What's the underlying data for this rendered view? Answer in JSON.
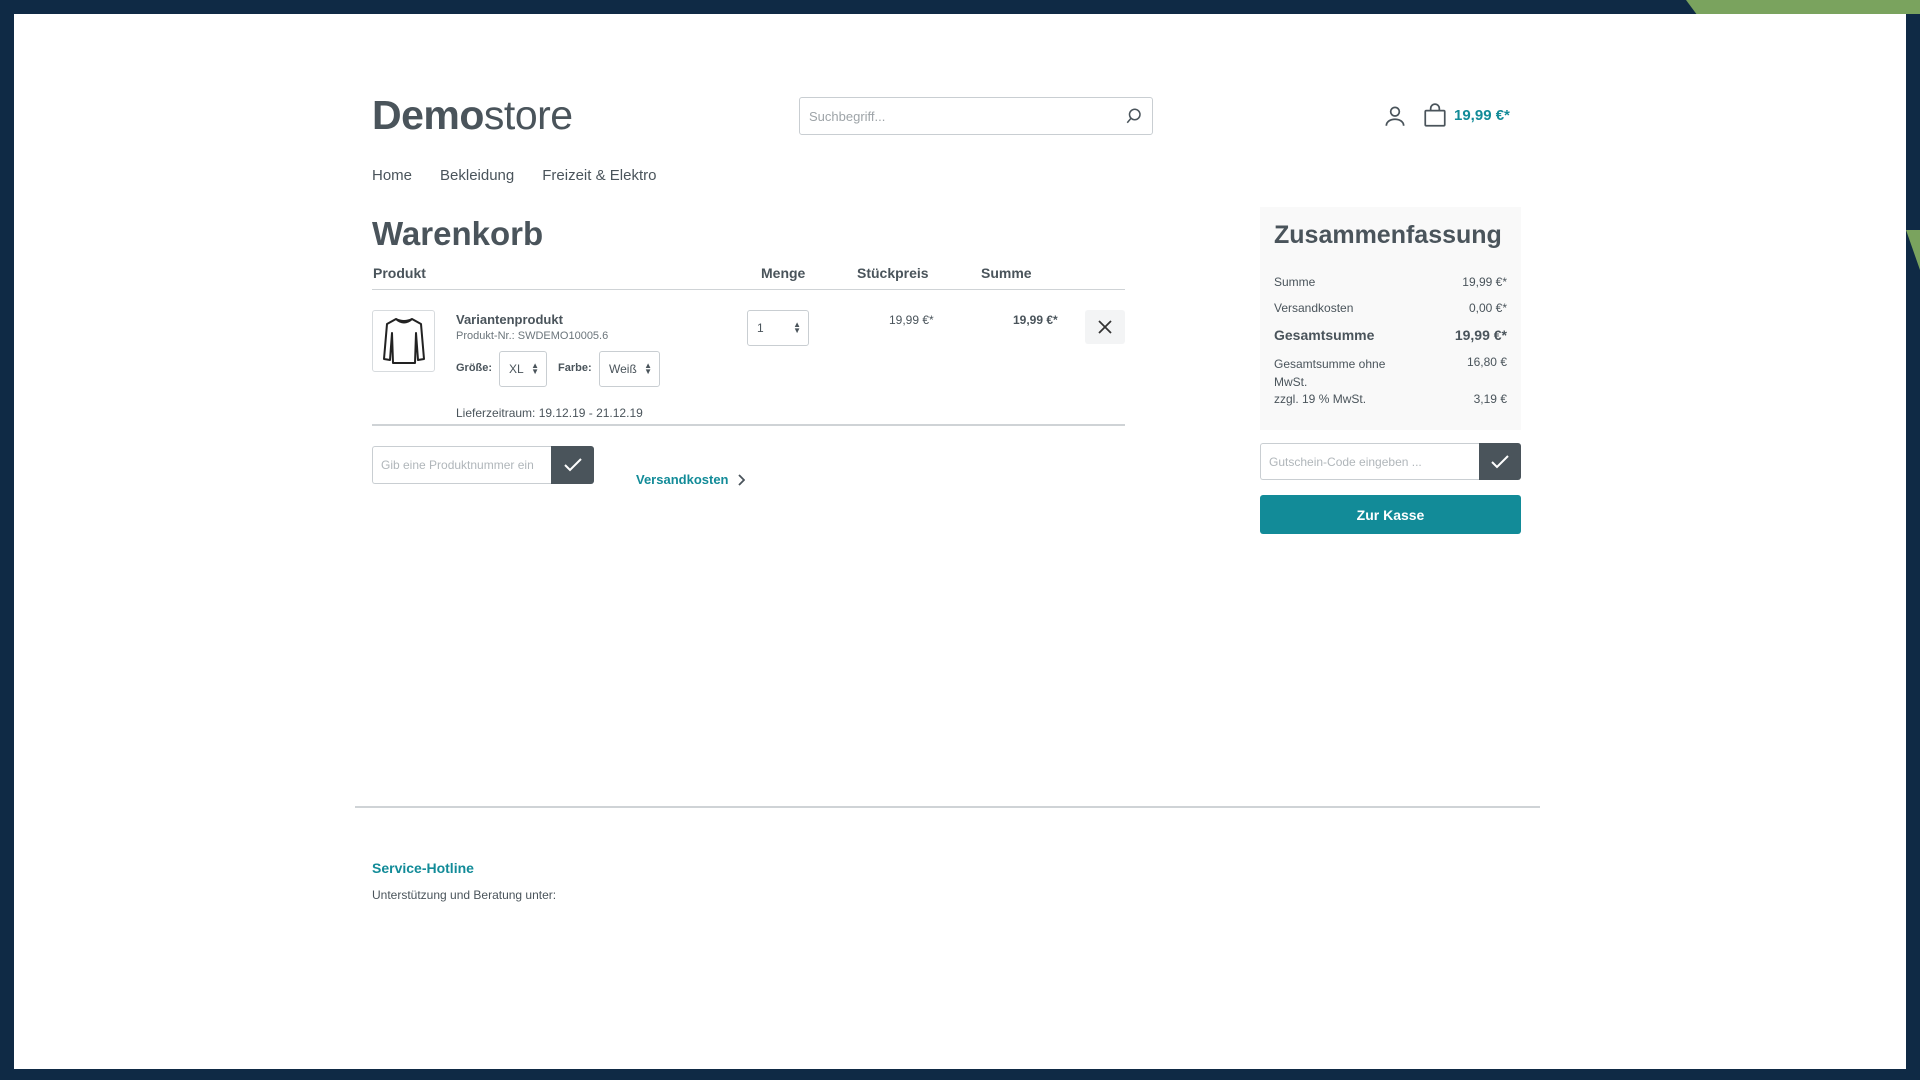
{
  "brand": {
    "logo_bold": "Demo",
    "logo_light": "store"
  },
  "search": {
    "placeholder": "Suchbegriff..."
  },
  "header": {
    "cart_total": "19,99 €*"
  },
  "nav": {
    "items": [
      "Home",
      "Bekleidung",
      "Freizeit & Elektro"
    ]
  },
  "cart": {
    "title": "Warenkorb",
    "columns": {
      "product": "Produkt",
      "quantity": "Menge",
      "unit_price": "Stückpreis",
      "sum": "Summe"
    },
    "items": [
      {
        "name": "Variantenprodukt",
        "product_number": "Produkt-Nr.: SWDEMO10005.6",
        "size_label": "Größe:",
        "size_value": "XL",
        "color_label": "Farbe:",
        "color_value": "Weiß",
        "delivery": "Lieferzeitraum: 19.12.19 - 21.12.19",
        "quantity": "1",
        "unit_price": "19,99 €*",
        "sum": "19,99 €*"
      }
    ],
    "add_product_placeholder": "Gib eine Produktnummer ein",
    "shipping_link": "Versandkosten"
  },
  "summary": {
    "title": "Zusammenfassung",
    "subtotal_label": "Summe",
    "subtotal_value": "19,99 €*",
    "shipping_label": "Versandkosten",
    "shipping_value": "0,00 €*",
    "total_label": "Gesamtsumme",
    "total_value": "19,99 €*",
    "net_label": "Gesamtsumme ohne MwSt.",
    "net_value": "16,80 €",
    "tax_label": "zzgl. 19 % MwSt.",
    "tax_value": "3,19 €",
    "voucher_placeholder": "Gutschein-Code eingeben ...",
    "checkout_label": "Zur Kasse"
  },
  "footer": {
    "hotline_title": "Service-Hotline",
    "hotline_text": "Unterstützung und Beratung unter:"
  },
  "colors": {
    "accent": "#128b98",
    "text": "#4a545b",
    "frame": "#0f2a45",
    "corner": "#7aa35e"
  }
}
